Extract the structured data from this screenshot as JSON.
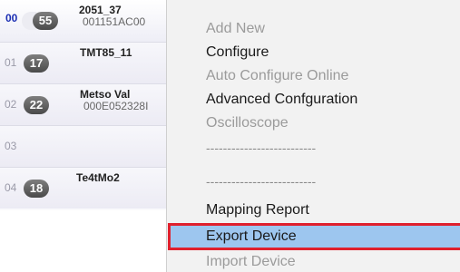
{
  "devices": [
    {
      "index": "00",
      "address": "55",
      "name": "2051_37",
      "id": "001151AC00"
    },
    {
      "index": "01",
      "address": "17",
      "name": "TMT85_11",
      "id": ""
    },
    {
      "index": "02",
      "address": "22",
      "name": "Metso Val",
      "id": "000E052328I"
    },
    {
      "index": "03",
      "address": "",
      "name": "",
      "id": ""
    },
    {
      "index": "04",
      "address": "18",
      "name": "Te4tMo2",
      "id": ""
    }
  ],
  "menu": {
    "add_new": "Add New",
    "configure": "Configure",
    "auto_configure_online": "Auto Configure Online",
    "advanced_configuration": "Advanced Confguration",
    "oscilloscope": "Oscilloscope",
    "separator_1": "--------------------------",
    "separator_2": "--------------------------",
    "mapping_report": "Mapping Report",
    "export_device": "Export Device",
    "import_device": "Import Device"
  },
  "colors": {
    "selection": "#9dc6ef",
    "highlight_border": "#e0202d",
    "active_index": "#1c2fb3"
  }
}
